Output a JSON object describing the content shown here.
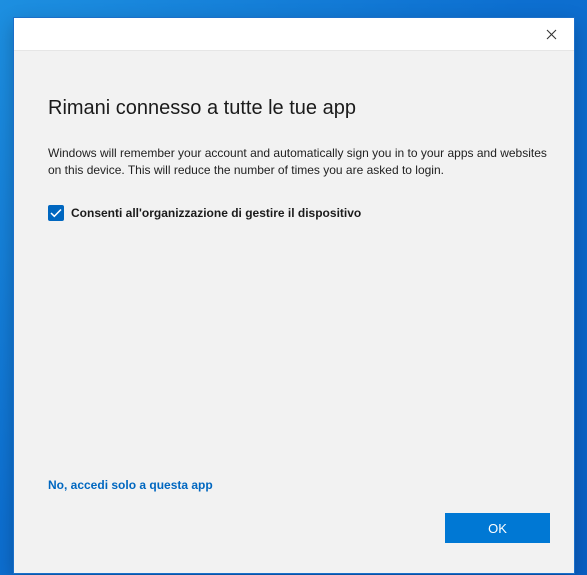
{
  "dialog": {
    "close_icon": "close-icon",
    "heading": "Rimani connesso a tutte le tue app",
    "description": "Windows will remember your account and automatically sign you in to your apps and websites on this device. This will reduce the number of times you are asked to login.",
    "checkbox": {
      "label": "Consenti all'organizzazione di gestire il dispositivo",
      "checked": true,
      "icon": "checkmark-icon"
    },
    "alt_link": "No, accedi solo a questa app",
    "ok_label": "OK"
  },
  "colors": {
    "accent": "#0078d4",
    "link": "#0067c0",
    "dialog_bg": "#f2f2f2",
    "desktop": "#0d6fd0"
  }
}
